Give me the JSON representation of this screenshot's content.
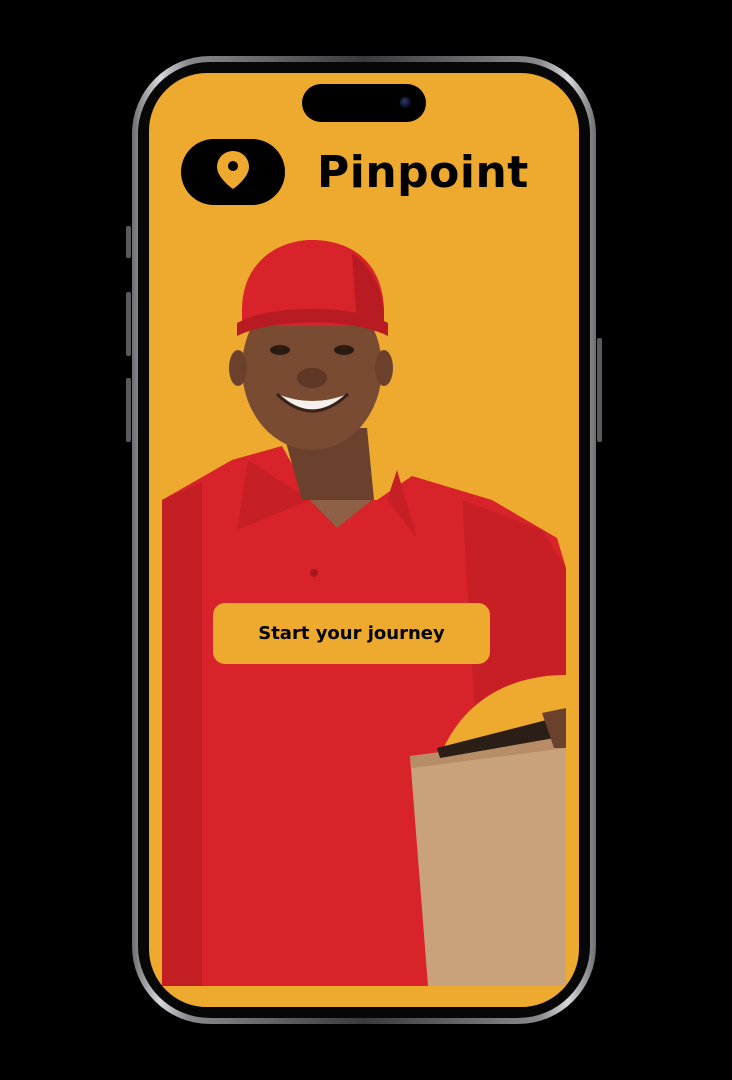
{
  "app": {
    "name": "Pinpoint",
    "logo_icon": "map-pin-icon"
  },
  "hero": {
    "subject": "delivery-person-with-box"
  },
  "cta": {
    "label": "Start your journey"
  },
  "colors": {
    "accent": "#EEA92F",
    "brand_text": "#000000",
    "shirt": "#D8232A",
    "box": "#C9A17A"
  }
}
